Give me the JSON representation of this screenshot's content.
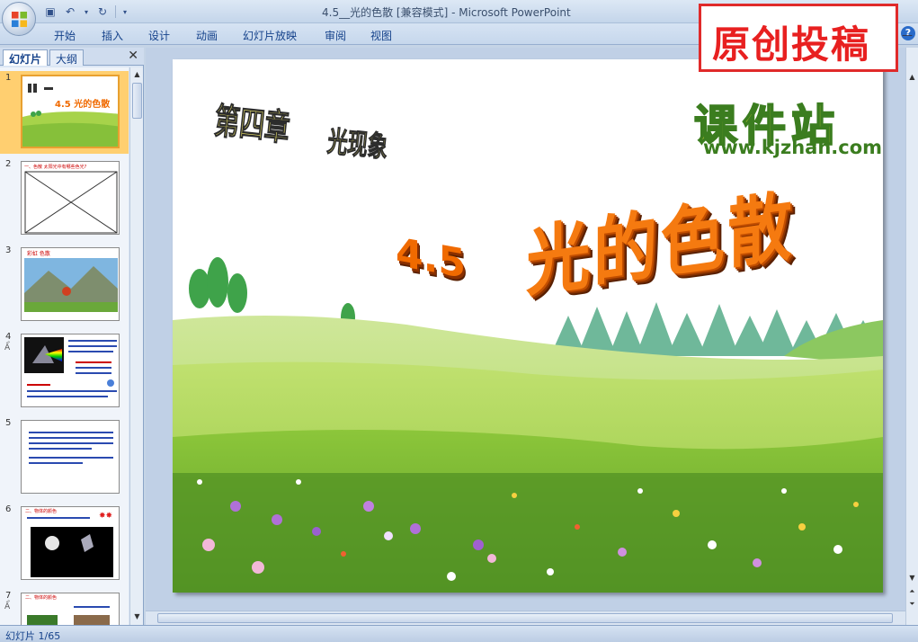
{
  "window": {
    "title": "4.5__光的色散 [兼容模式] - Microsoft PowerPoint"
  },
  "ribbon": {
    "tabs": [
      "开始",
      "插入",
      "设计",
      "动画",
      "幻灯片放映",
      "审阅",
      "视图"
    ]
  },
  "banner": {
    "text": "原创投稿"
  },
  "slides_panel": {
    "tabs": [
      "幻灯片",
      "大纲"
    ],
    "active_tab": "幻灯片",
    "thumbnails": [
      {
        "number": "1",
        "selected": true
      },
      {
        "number": "2"
      },
      {
        "number": "3"
      },
      {
        "number": "4",
        "animation": "Ẩ"
      },
      {
        "number": "5"
      },
      {
        "number": "6"
      },
      {
        "number": "7",
        "animation": "Ẩ"
      }
    ]
  },
  "slide": {
    "chapter": "第四章",
    "chapter_subject": "光现象",
    "section_number": "4.5",
    "section_title": "光的色散",
    "watermark_title": "课件站",
    "watermark_url": "www.kjzhan.com"
  },
  "thumb_texts": {
    "t1": "4.5 光的色散",
    "t2": "一、色散  太阳光中有哪些色光?",
    "t3": "彩虹  色散",
    "t6": "二、物体的颜色",
    "t7": "二、物体的颜色"
  },
  "status": {
    "text": "幻灯片 1/65"
  },
  "colors": {
    "accent_red": "#e02a2a",
    "ribbon_text": "#15428b",
    "title_orange": "#f57a10",
    "grass_green": "#9dcf3b"
  }
}
